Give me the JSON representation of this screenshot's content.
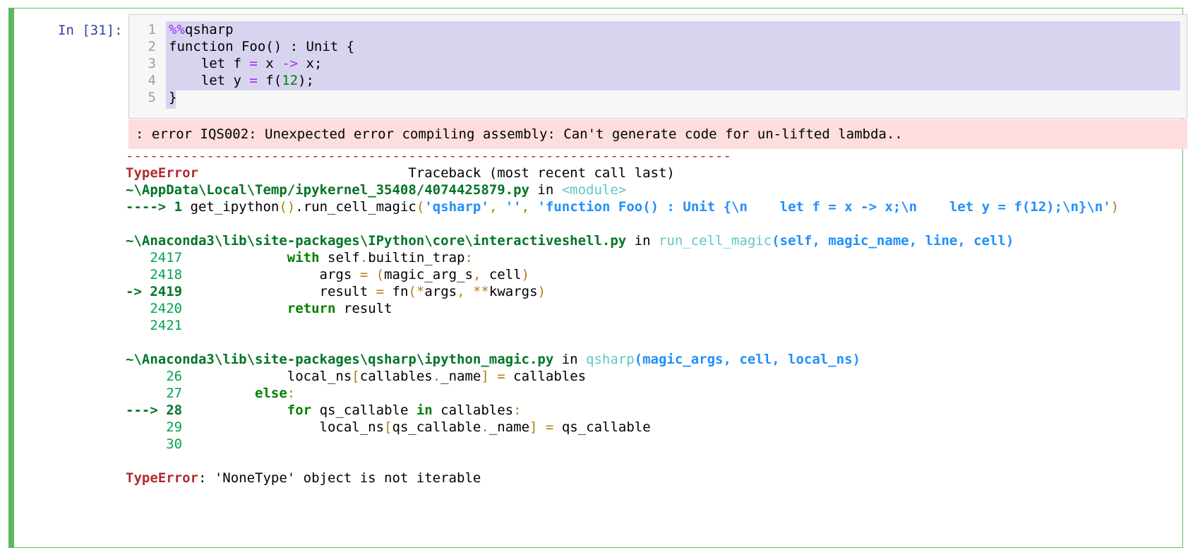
{
  "prompt": "In [31]:",
  "code": {
    "line_numbers": [
      "1",
      "2",
      "3",
      "4",
      "5"
    ],
    "l1_magic": "%%",
    "l1_rest": "qsharp",
    "l2": "function Foo() : Unit {",
    "l3_a": "    let f ",
    "l3_eq": "=",
    "l3_b": " x ",
    "l3_arrow": "->",
    "l3_c": " x;",
    "l4_a": "    let y ",
    "l4_eq": "=",
    "l4_b": " f(",
    "l4_num": "12",
    "l4_c": ");",
    "l5": "}"
  },
  "stderr": ": error IQS002: Unexpected error compiling assembly: Can't generate code for un-lifted lambda..",
  "traceback": {
    "dashes": "---------------------------------------------------------------------------",
    "error_type": "TypeError",
    "header_right": "                          Traceback (most recent call last)",
    "f1_path": "~\\AppData\\Local\\Temp/ipykernel_35408/4074425879.py",
    "in": " in ",
    "f1_func": "<module>",
    "f1_arrow": "----> 1 ",
    "f1_call_a": "get_ipython",
    "f1_call_paren": "()",
    "f1_call_b": ".run_cell_magic",
    "f1_open": "(",
    "f1_arg1": "'qsharp'",
    "f1_comma1": ", ",
    "f1_arg2": "''",
    "f1_comma2": ", ",
    "f1_arg3": "'function Foo() : Unit {\\n    let f = x -> x;\\n    let y = f(12);\\n}\\n'",
    "f1_close": ")",
    "f2_path": "~\\Anaconda3\\lib\\site-packages\\IPython\\core\\interactiveshell.py",
    "f2_func": "run_cell_magic",
    "f2_args": "(self, magic_name, line, cell)",
    "f2_lines": [
      {
        "no": "   2417",
        "pre": "             ",
        "kw": "with",
        "text": " self",
        "dot": ".",
        "rest": "builtin_trap",
        "colon": ":"
      },
      {
        "no": "   2418",
        "text": "                 args ",
        "eq": "=",
        "p1": " (",
        "mid": "magic_arg_s",
        "c": ",",
        "mid2": " cell",
        "p2": ")"
      },
      {
        "arrow": "-> 2419",
        "text": "                 result ",
        "eq": "=",
        "mid": " fn",
        "p1": "(",
        "star": "*",
        "mid2": "args",
        "c": ",",
        "sp": " ",
        "star2": "**",
        "mid3": "kwargs",
        "p2": ")"
      },
      {
        "no": "   2420",
        "pre": "             ",
        "kw": "return",
        "text": " result"
      },
      {
        "no": "   2421"
      }
    ],
    "f3_path": "~\\Anaconda3\\lib\\site-packages\\qsharp\\ipython_magic.py",
    "f3_func": "qsharp",
    "f3_args": "(magic_args, cell, local_ns)",
    "f3_lines": [
      {
        "no": "     26",
        "text": "             local_ns",
        "b1": "[",
        "mid": "callables",
        "dot": ".",
        "mid2": "_name",
        "b2": "]",
        "sp": " ",
        "eq": "=",
        "rest": " callables"
      },
      {
        "no": "     27",
        "pre": "         ",
        "kw": "else",
        "colon": ":"
      },
      {
        "arrow": "---> 28",
        "pre": "             ",
        "kw": "for",
        "text": " qs_callable ",
        "kw2": "in",
        "rest": " callables",
        "colon": ":"
      },
      {
        "no": "     29",
        "text": "                 local_ns",
        "b1": "[",
        "mid": "qs_callable",
        "dot": ".",
        "mid2": "_name",
        "b2": "]",
        "sp": " ",
        "eq": "=",
        "rest": " qs_callable"
      },
      {
        "no": "     30"
      }
    ],
    "final_type": "TypeError",
    "final_msg": ": 'NoneType' object is not iterable"
  }
}
